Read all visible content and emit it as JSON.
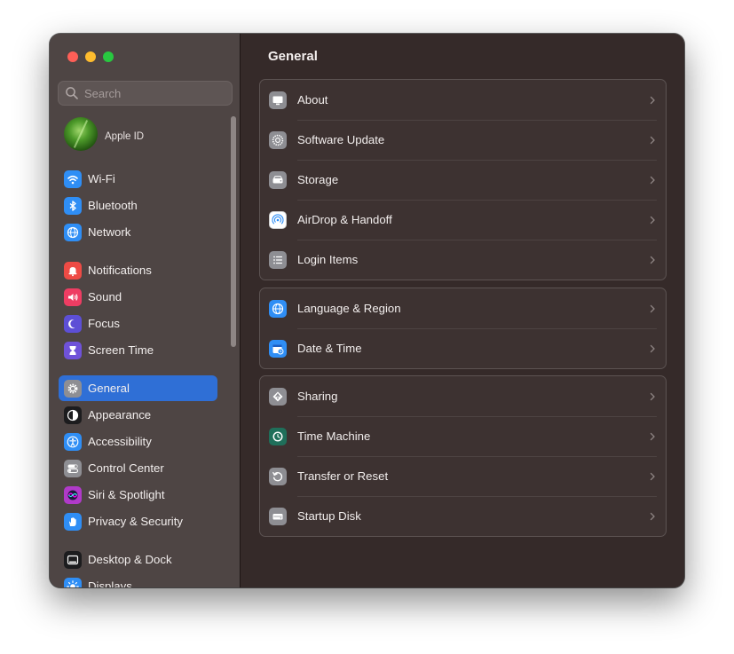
{
  "search": {
    "placeholder": "Search"
  },
  "apple_id": {
    "label": "Apple ID"
  },
  "sidebar": {
    "items": [
      {
        "label": "Wi-Fi",
        "icon": "wifi-icon",
        "color": "#2f8ef5"
      },
      {
        "label": "Bluetooth",
        "icon": "bluetooth-icon",
        "color": "#2f8ef5"
      },
      {
        "label": "Network",
        "icon": "globe-icon",
        "color": "#2f8ef5"
      },
      {
        "label": "Notifications",
        "icon": "bell-icon",
        "color": "#ee4b45"
      },
      {
        "label": "Sound",
        "icon": "speaker-icon",
        "color": "#ee3d63"
      },
      {
        "label": "Focus",
        "icon": "moon-icon",
        "color": "#5d4fd6"
      },
      {
        "label": "Screen Time",
        "icon": "hourglass-icon",
        "color": "#6f52d9"
      },
      {
        "label": "General",
        "icon": "gear-icon",
        "color": "#8e8e93",
        "selected": true
      },
      {
        "label": "Appearance",
        "icon": "appearance-icon",
        "color": "#1c1c1e"
      },
      {
        "label": "Accessibility",
        "icon": "accessibility-icon",
        "color": "#2f8ef5"
      },
      {
        "label": "Control Center",
        "icon": "toggles-icon",
        "color": "#8e8e93"
      },
      {
        "label": "Siri & Spotlight",
        "icon": "siri-icon",
        "color": "#b03ac9"
      },
      {
        "label": "Privacy & Security",
        "icon": "hand-icon",
        "color": "#2f8ef5"
      },
      {
        "label": "Desktop & Dock",
        "icon": "dock-icon",
        "color": "#1c1c1e"
      },
      {
        "label": "Displays",
        "icon": "sun-icon",
        "color": "#2f8ef5"
      }
    ]
  },
  "main": {
    "title": "General",
    "groups": [
      [
        {
          "label": "About",
          "icon": "monitor-icon",
          "color": "#8e8e93"
        },
        {
          "label": "Software Update",
          "icon": "update-gear-icon",
          "color": "#8e8e93"
        },
        {
          "label": "Storage",
          "icon": "drive-icon",
          "color": "#8e8e93"
        },
        {
          "label": "AirDrop & Handoff",
          "icon": "airdrop-icon",
          "color": "#ffffff"
        },
        {
          "label": "Login Items",
          "icon": "list-icon",
          "color": "#8e8e93"
        }
      ],
      [
        {
          "label": "Language & Region",
          "icon": "globe-icon",
          "color": "#2f8ef5"
        },
        {
          "label": "Date & Time",
          "icon": "calendar-clock-icon",
          "color": "#2f8ef5"
        }
      ],
      [
        {
          "label": "Sharing",
          "icon": "sharing-icon",
          "color": "#8e8e93"
        },
        {
          "label": "Time Machine",
          "icon": "time-machine-icon",
          "color": "#1f6f5a"
        },
        {
          "label": "Transfer or Reset",
          "icon": "reset-icon",
          "color": "#8e8e93"
        },
        {
          "label": "Startup Disk",
          "icon": "disk-icon",
          "color": "#8e8e93"
        }
      ]
    ]
  }
}
